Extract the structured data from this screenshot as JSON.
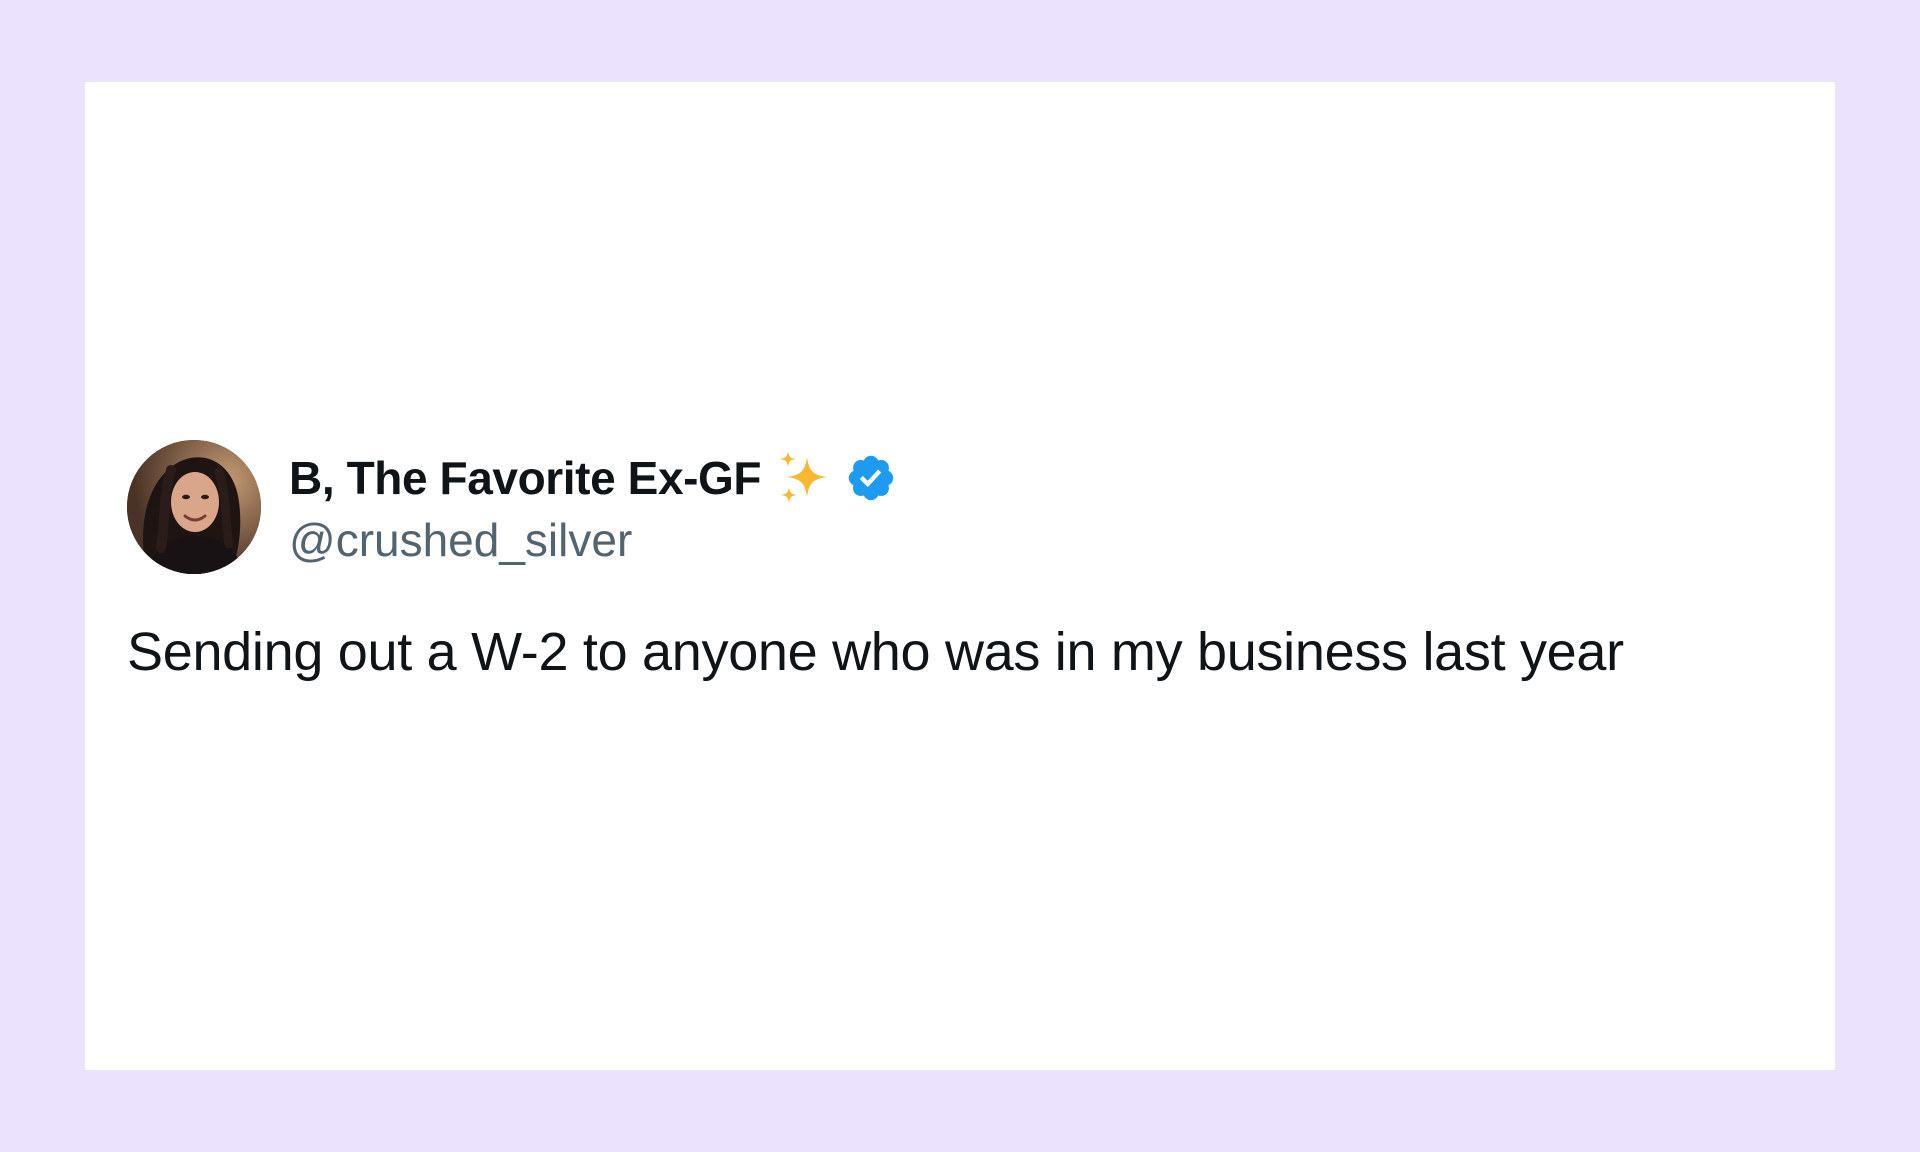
{
  "tweet": {
    "display_name": "B, The Favorite Ex-GF",
    "handle": "@crushed_silver",
    "text": "Sending out a W-2 to anyone who was in my business last year",
    "emoji_icon": "sparkles-icon",
    "badge_icon": "verified-badge-icon"
  },
  "colors": {
    "page_background": "#ebe3fe",
    "card_background": "#ffffff",
    "name_color": "#0f1419",
    "handle_color": "#536471",
    "verified_blue": "#1d9bf0",
    "sparkle_yellow": "#f7b731"
  }
}
